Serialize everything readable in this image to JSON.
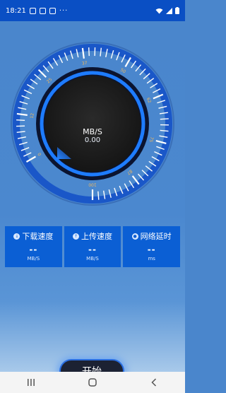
{
  "status_bar": {
    "time": "18:21",
    "more": "···",
    "icons": [
      "image-icon",
      "notification-icon",
      "notification-icon-2",
      "wifi-icon",
      "signal-icon",
      "battery-icon"
    ]
  },
  "gauge": {
    "unit": "MB/S",
    "value": "0.00",
    "tick_labels": [
      "0",
      "12",
      "25",
      "37",
      "50",
      "62",
      "75",
      "87",
      "100"
    ],
    "level": 0
  },
  "stats": [
    {
      "label": "下载速度",
      "value": "--",
      "unit": "MB/S",
      "icon": "download-icon"
    },
    {
      "label": "上传速度",
      "value": "--",
      "unit": "MB/S",
      "icon": "upload-icon"
    },
    {
      "label": "网络延时",
      "value": "--",
      "unit": "ms",
      "icon": "latency-icon"
    }
  ],
  "start_button": "开始",
  "nav": {
    "recent": "|||",
    "home": "○",
    "back": "‹"
  },
  "colors": {
    "background": "#4a86cc",
    "status_bar": "#0a4fc4",
    "accent": "#1e7cff",
    "stat_box": "#0b5fd4",
    "gauge_face": "#1f1f1f",
    "tick_label": "#f2b85a"
  }
}
